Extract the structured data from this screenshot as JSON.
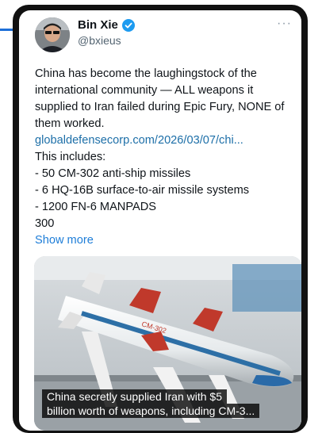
{
  "author": {
    "display_name": "Bin Xie",
    "handle": "@bxieus",
    "verified": true
  },
  "menu_icon": "more-horizontal-icon",
  "post": {
    "text": "China has become the laughingstock of the international community — ALL weapons it supplied to Iran failed during Epic Fury, NONE of them worked.",
    "link": "globaldefensecorp.com/2026/03/07/chi...",
    "intro": "This includes:",
    "items": [
      "- 50 CM-302 anti-ship missiles",
      "- 6 HQ-16B surface-to-air missile systems",
      "- 1200 FN-6 MANPADS",
      "300"
    ],
    "show_more": "Show more"
  },
  "media": {
    "missile_marking": "CM-302",
    "caption_line1": "China secretly supplied Iran with $5",
    "caption_line2": "billion worth of weapons, including CM-3..."
  },
  "colors": {
    "accent": "#1d6fd8",
    "link": "#1d6fa8",
    "verified_badge": "#1d9bf0"
  }
}
